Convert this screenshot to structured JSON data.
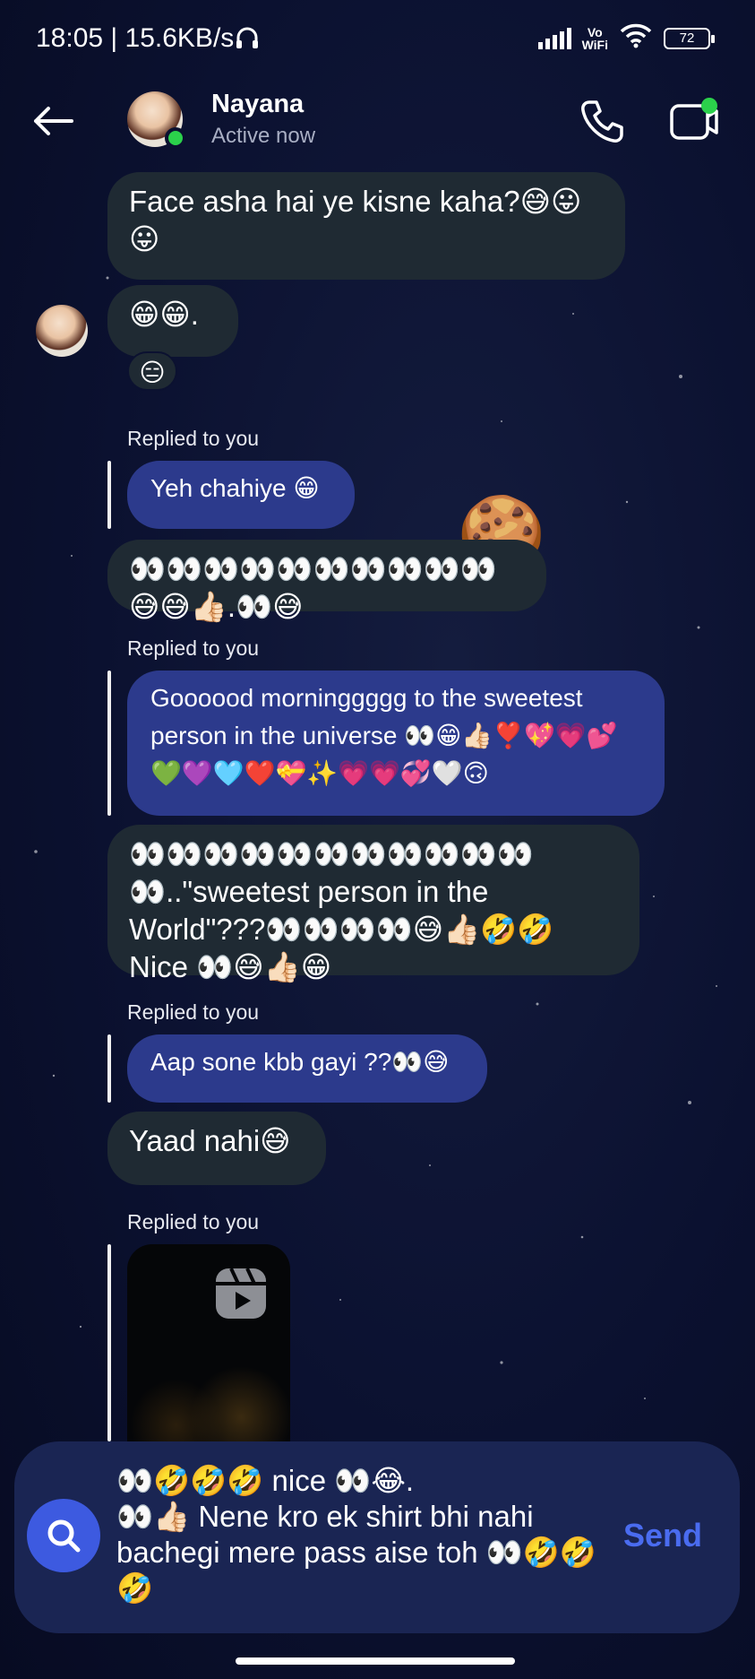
{
  "status_bar": {
    "time_speed": "18:05 | 15.6KB/s",
    "network_label": "Vo\nWiFi",
    "battery": "72"
  },
  "header": {
    "name": "Nayana",
    "status": "Active now"
  },
  "messages": {
    "m1": "Face asha hai ye kisne kaha?😅😛😛",
    "m2": "😁😁.",
    "m2_reaction": "😑",
    "r1_label": "Replied to you",
    "r1_quote": "Yeh chahiye 😁",
    "m3": "👀👀👀👀👀👀👀👀👀👀😅😅👍🏻.👀😅",
    "r2_label": "Replied to you",
    "r2_quote": "Goooood morninggggg to the sweetest person in the universe 👀😁👍🏻❣️💖💗💕💚💜🩵❤️💝✨💗💗💞🤍🙃",
    "m4": "👀👀👀👀👀👀👀👀👀👀👀👀..\"sweetest person in the World\"???👀👀👀👀😅👍🏻🤣🤣 Nice 👀😅👍🏻😁",
    "r3_label": "Replied to you",
    "r3_quote": "Aap sone kbb gayi ??👀😅",
    "m5": "Yaad nahi😅",
    "r4_label": "Replied to you",
    "sticker": "🍪"
  },
  "composer": {
    "text": "👀🤣🤣🤣 nice 👀😂.\n👀👍🏻 Nene kro ek shirt bhi nahi bachegi mere pass aise toh 👀🤣🤣🤣",
    "send_label": "Send"
  },
  "colors": {
    "background": "#0b1130",
    "incoming_bubble": "#1f2a33",
    "reply_bubble": "#2c3a8c",
    "composer": "#1a2553",
    "accent": "#4a6cf0",
    "online": "#2bd14b"
  }
}
